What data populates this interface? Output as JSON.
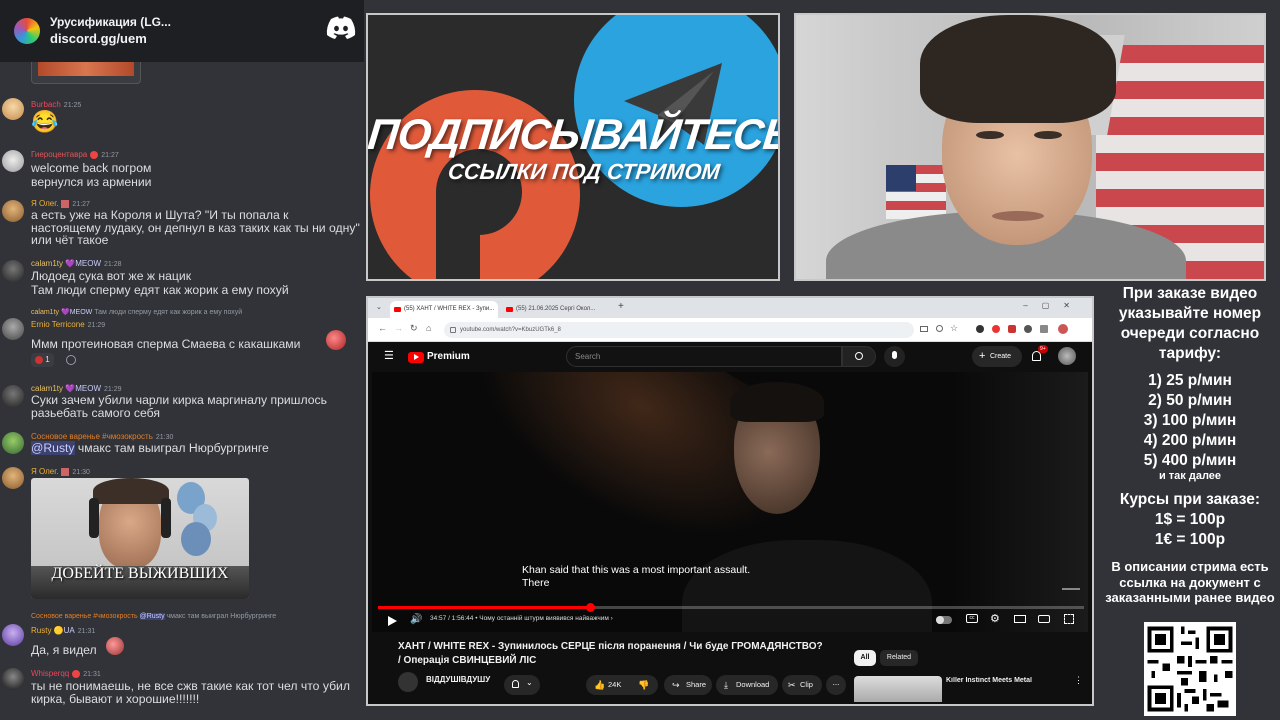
{
  "discord": {
    "server_name": "Урусификация (LG...",
    "invite": "discord.gg/uem",
    "messages": [
      {
        "user": "Burbach",
        "time": "21:25",
        "text": "😂"
      },
      {
        "user": "Гиероцентавра",
        "time": "21:27",
        "text": "welcome back погром\nвернулся из армении"
      },
      {
        "user": "Я Олег.",
        "time": "21:27",
        "text": "а есть уже на Короля и Шута? \"И ты попала к настоящему лудаку, он депнул в каз таких как ты ни одну\" или чёт такое"
      },
      {
        "user": "calam1ty",
        "badge": "MEOW",
        "time": "21:28",
        "text": "Людоед сука вот же ж нацик\nТам люди сперму едят как жорик а ему похуй"
      },
      {
        "reply_to": "calam1ty",
        "reply_badge": "MEOW",
        "reply_text": "Там люди сперму едят как жорик а ему похуй",
        "user": "Ernio Terricone",
        "time": "21:29",
        "text": "Ммм протеиновая сперма Смаева с какашками",
        "reaction_count": "1"
      },
      {
        "user": "calam1ty",
        "badge": "MEOW",
        "time": "21:29",
        "text": "Суки зачем убили чарли кирка маргиналу пришлось разьебать самого себя"
      },
      {
        "user": "Сосновое варенье #чмозокрость",
        "time": "21:30",
        "mention": "@Rusty",
        "text": " чмакс там выиграл Нюрбургринге"
      },
      {
        "user": "Я Олег.",
        "time": "21:30",
        "image_caption": "ДОБЕЙТЕ ВЫЖИВШИХ"
      },
      {
        "reply_to": "Сосновое варенье #чмозокрость",
        "reply_mention": "@Rusty",
        "reply_text": " чмакс там выиграл Нюрбургринге",
        "user": "Rusty",
        "badge": "UA",
        "time": "21:31",
        "text": "Да, я видел"
      },
      {
        "user": "Whisperqq",
        "time": "21:31",
        "text": "ты не понимаешь, не все сжв такие как тот чел что убил кирка, бывают и хорошие!!!!!!!"
      }
    ]
  },
  "banner": {
    "line1": "ПОДПИСЫВАЙТЕСЬ",
    "line2": "ССЫЛКИ ПОД СТРИМОМ"
  },
  "browser": {
    "tabs": [
      "(55) ХАНТ / WHITE REX - Зупи...",
      "(55) 21.06.2025 Сергі Окол..."
    ],
    "url": "youtube.com/watch?v=KbuzUGTk6_8",
    "search_placeholder": "Search",
    "logo": "Premium",
    "create_label": "Create",
    "notif_count": "9+",
    "subtitle_line1": "Khan said that this was a most important assault.",
    "subtitle_line2": "There",
    "time_display": "34:57 / 1:56:44",
    "chapter": "• Чому останній штурм виявився найважчим",
    "chapter_arrow": "›",
    "video_title": "ХАНТ / WHITE REX - Зупинилось СЕРЦЕ після поранення / Чи буде ГРОМАДЯНСТВО? / Операція СВИНЦЕВИЙ ЛІС",
    "channel": "ВІДДУШІВДУШУ",
    "likes": "24K",
    "share": "Share",
    "download": "Download",
    "clip": "Clip",
    "more": "...",
    "filter_all": "All",
    "filter_related": "Related",
    "related_title": "Killer Instinct Meets Metal",
    "progress": 0.3,
    "volume": 0.6
  },
  "info": {
    "intro": "При заказе видео указывайте номер очереди согласно тарифу:",
    "tiers": [
      "1) 25 р/мин",
      "2) 50 р/мин",
      "3) 100 р/мин",
      "4) 200 р/мин",
      "5) 400 р/мин"
    ],
    "etc": "и так далее",
    "rates_title": "Курсы при заказе:",
    "rates": [
      "1$ = 100р",
      "1€ = 100р"
    ],
    "footer": "В описании стрима есть ссылка на документ с заказанными ранее видео"
  }
}
